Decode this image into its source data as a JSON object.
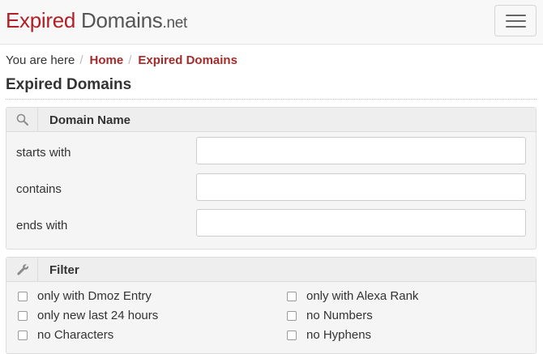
{
  "header": {
    "logo_part1": "Expired",
    "logo_part2": "Domains",
    "logo_part3": ".net",
    "menu_icon": "hamburger-menu-icon"
  },
  "breadcrumb": {
    "prefix": "You are here",
    "separator": "/",
    "items": [
      "Home",
      "Expired Domains"
    ]
  },
  "page_title": "Expired Domains",
  "domain_panel": {
    "icon": "search-icon",
    "title": "Domain Name",
    "rows": [
      {
        "label": "starts with",
        "value": ""
      },
      {
        "label": "contains",
        "value": ""
      },
      {
        "label": "ends with",
        "value": ""
      }
    ]
  },
  "filter_panel": {
    "icon": "wrench-icon",
    "title": "Filter",
    "checkboxes": [
      {
        "label": "only with Dmoz Entry",
        "checked": false
      },
      {
        "label": "only with Alexa Rank",
        "checked": false
      },
      {
        "label": "only new last 24 hours",
        "checked": false
      },
      {
        "label": "no Numbers",
        "checked": false
      },
      {
        "label": "no Characters",
        "checked": false
      },
      {
        "label": "no Hyphens",
        "checked": false
      }
    ]
  },
  "colors": {
    "brand_red": "#b21f24",
    "link_red": "#a52a2a"
  }
}
